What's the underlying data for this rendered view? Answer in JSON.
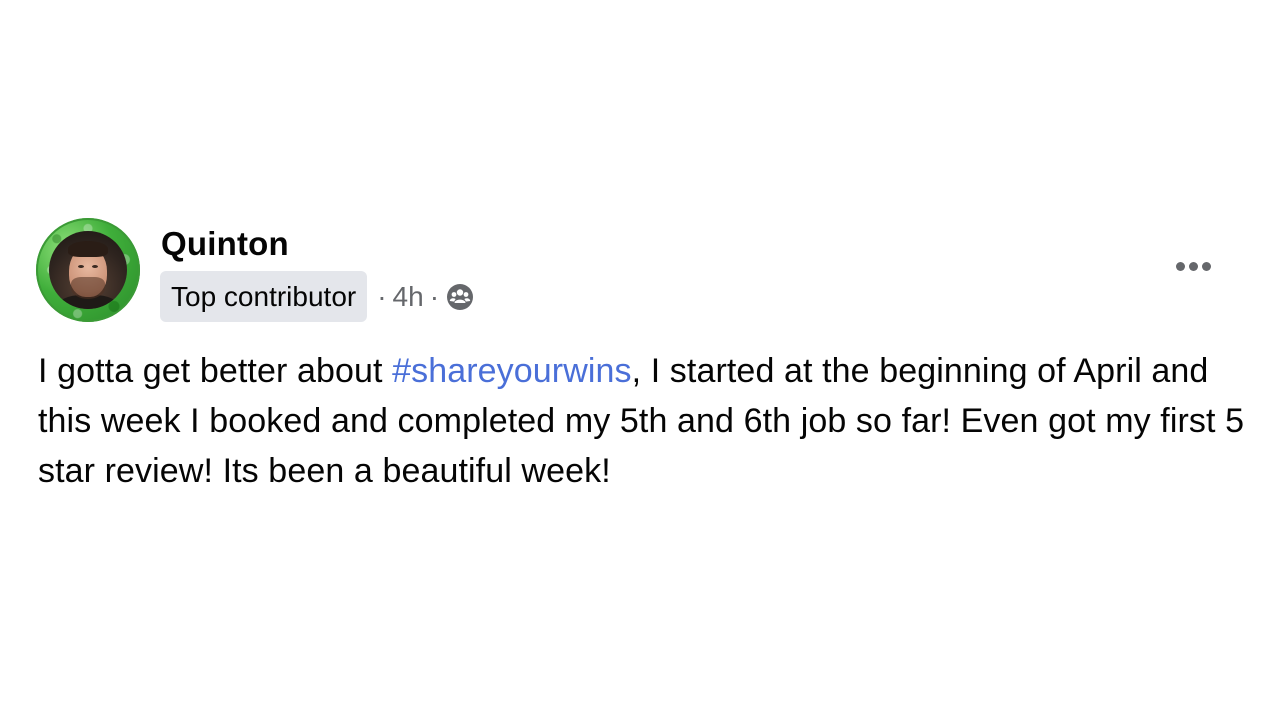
{
  "post": {
    "author": {
      "name": "Quinton",
      "badge": "Top contributor",
      "avatar_icon": "profile-photo"
    },
    "meta": {
      "separator": "·",
      "time": "4h",
      "privacy_icon": "group-members-icon"
    },
    "body": {
      "text_before": "I gotta get better about ",
      "hashtag": "#shareyourwins",
      "text_after": ", I started at the beginning of April and this week I booked and completed my 5th and 6th job so far! Even got my first 5 star review! Its been a beautiful week!"
    },
    "more_icon": "more-options-icon"
  },
  "colors": {
    "background": "#ffffff",
    "text": "#050505",
    "secondary_text": "#65676b",
    "badge_bg": "#e4e6eb",
    "hashtag": "#4a6fd8",
    "avatar_ring": "#3fae3a"
  }
}
